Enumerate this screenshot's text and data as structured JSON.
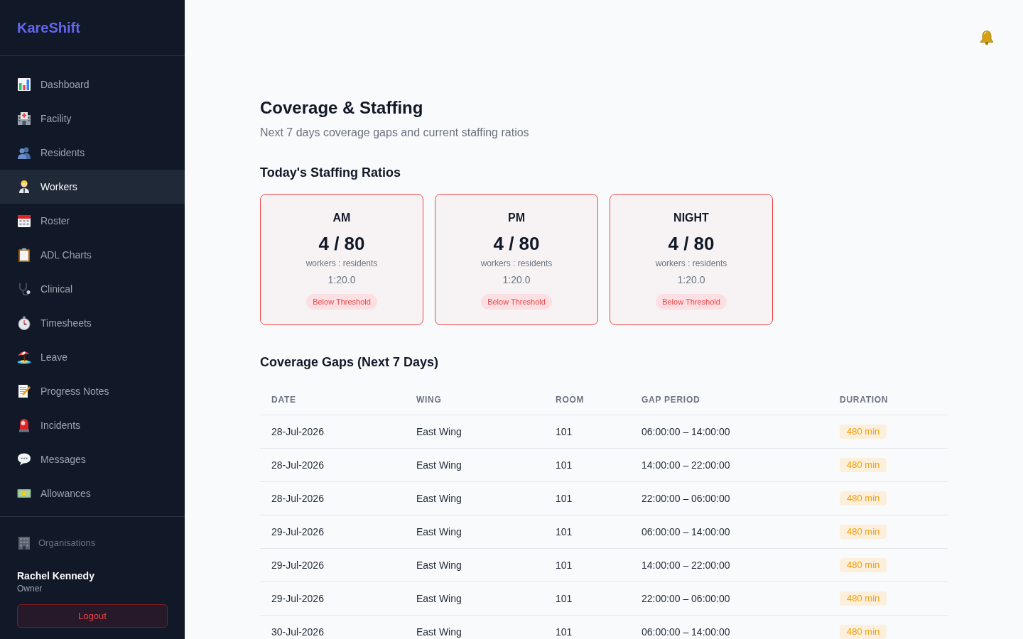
{
  "app": {
    "brand": "KareShift"
  },
  "sidebar": {
    "items": [
      {
        "label": "Dashboard",
        "selected": false
      },
      {
        "label": "Facility",
        "selected": false
      },
      {
        "label": "Residents",
        "selected": false
      },
      {
        "label": "Workers",
        "selected": true
      },
      {
        "label": "Roster",
        "selected": false
      },
      {
        "label": "ADL Charts",
        "selected": false
      },
      {
        "label": "Clinical",
        "selected": false
      },
      {
        "label": "Timesheets",
        "selected": false
      },
      {
        "label": "Leave",
        "selected": false
      },
      {
        "label": "Progress Notes",
        "selected": false
      },
      {
        "label": "Incidents",
        "selected": false
      },
      {
        "label": "Messages",
        "selected": false
      },
      {
        "label": "Allowances",
        "selected": false
      }
    ],
    "footer_link": "Organisations",
    "user": {
      "name": "Rachel Kennedy",
      "role": "Owner"
    },
    "logout": "Logout"
  },
  "page": {
    "title": "Coverage & Staffing",
    "subtitle": "Next 7 days coverage gaps and current staffing ratios"
  },
  "ratios": {
    "heading": "Today's Staffing Ratios",
    "cards": [
      {
        "shift": "AM",
        "count": "4 / 80",
        "caption": "workers : residents",
        "ratio": "1:20.0",
        "below_threshold": true,
        "status": "Below Threshold"
      },
      {
        "shift": "PM",
        "count": "4 / 80",
        "caption": "workers : residents",
        "ratio": "1:20.0",
        "below_threshold": true,
        "status": "Below Threshold"
      },
      {
        "shift": "NIGHT",
        "count": "4 / 80",
        "caption": "workers : residents",
        "ratio": "1:20.0",
        "below_threshold": true,
        "status": "Below Threshold"
      }
    ]
  },
  "gaps": {
    "heading": "Coverage Gaps (Next 7 Days)",
    "columns": [
      "DATE",
      "WING",
      "ROOM",
      "GAP PERIOD",
      "DURATION"
    ],
    "rows": [
      {
        "date": "28-Jul-2026",
        "wing": "East Wing",
        "room": "101",
        "period": "06:00:00 – 14:00:00",
        "duration": "480 min"
      },
      {
        "date": "28-Jul-2026",
        "wing": "East Wing",
        "room": "101",
        "period": "14:00:00 – 22:00:00",
        "duration": "480 min"
      },
      {
        "date": "28-Jul-2026",
        "wing": "East Wing",
        "room": "101",
        "period": "22:00:00 – 06:00:00",
        "duration": "480 min"
      },
      {
        "date": "29-Jul-2026",
        "wing": "East Wing",
        "room": "101",
        "period": "06:00:00 – 14:00:00",
        "duration": "480 min"
      },
      {
        "date": "29-Jul-2026",
        "wing": "East Wing",
        "room": "101",
        "period": "14:00:00 – 22:00:00",
        "duration": "480 min"
      },
      {
        "date": "29-Jul-2026",
        "wing": "East Wing",
        "room": "101",
        "period": "22:00:00 – 06:00:00",
        "duration": "480 min"
      },
      {
        "date": "30-Jul-2026",
        "wing": "East Wing",
        "room": "101",
        "period": "06:00:00 – 14:00:00",
        "duration": "480 min"
      }
    ]
  }
}
